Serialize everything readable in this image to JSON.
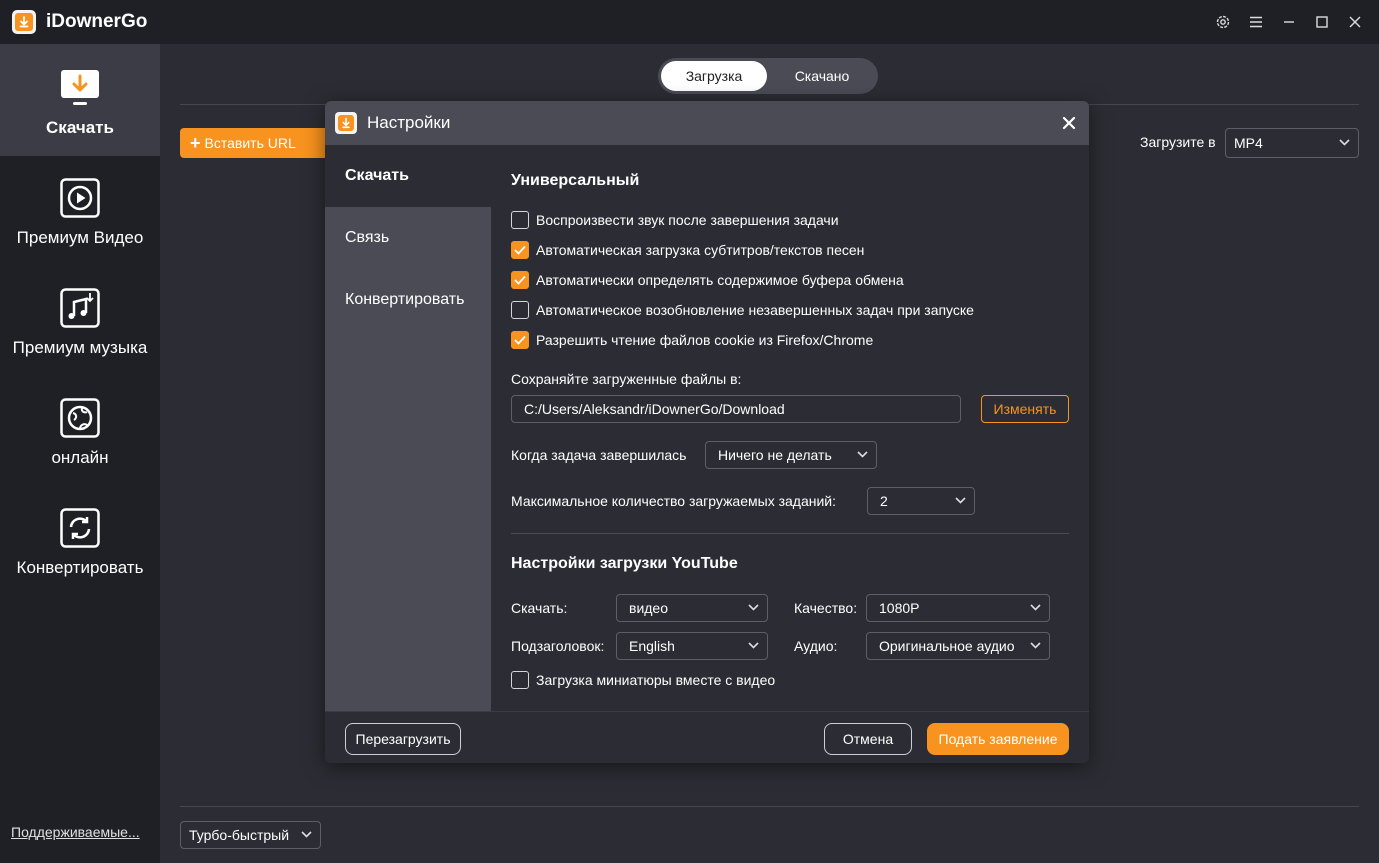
{
  "app": {
    "title": "iDownerGo"
  },
  "sidebar": {
    "items": [
      {
        "label": "Скачать",
        "icon": "download-monitor-icon",
        "active": true
      },
      {
        "label": "Премиум Видео",
        "icon": "play-icon"
      },
      {
        "label": "Премиум музыка",
        "icon": "music-icon"
      },
      {
        "label": "онлайн",
        "icon": "globe-icon"
      },
      {
        "label": "Конвертировать",
        "icon": "convert-icon"
      }
    ],
    "supported_link": "Поддерживаемые..."
  },
  "main": {
    "tabs": [
      {
        "label": "Загрузка",
        "active": true
      },
      {
        "label": "Скачано"
      }
    ],
    "paste_url": "Вставить URL",
    "download_in_label": "Загрузите в",
    "format": "MP4",
    "speed": "Турбо-быстрый"
  },
  "dialog": {
    "title": "Настройки",
    "nav": [
      {
        "label": "Скачать",
        "active": true
      },
      {
        "label": "Связь"
      },
      {
        "label": "Конвертировать"
      }
    ],
    "general": {
      "title": "Универсальный",
      "options": [
        {
          "label": "Воспроизвести звук после завершения задачи",
          "checked": false
        },
        {
          "label": "Автоматическая загрузка субтитров/текстов песен",
          "checked": true
        },
        {
          "label": "Автоматически определять содержимое буфера обмена",
          "checked": true
        },
        {
          "label": "Автоматическое возобновление незавершенных задач при запуске",
          "checked": false
        },
        {
          "label": "Разрешить чтение файлов cookie из Firefox/Chrome",
          "checked": true
        }
      ],
      "save_label": "Сохраняйте загруженные файлы в:",
      "save_path": "C:/Users/Aleksandr/iDownerGo/Download",
      "change_button": "Изменять",
      "on_complete_label": "Когда задача завершилась",
      "on_complete_value": "Ничего не делать",
      "max_tasks_label": "Максимальное количество загружаемых заданий:",
      "max_tasks_value": "2"
    },
    "youtube": {
      "title": "Настройки загрузки YouTube",
      "download_label": "Скачать:",
      "download_value": "видео",
      "quality_label": "Качество:",
      "quality_value": "1080P",
      "subtitle_label": "Подзаголовок:",
      "subtitle_value": "English",
      "audio_label": "Аудио:",
      "audio_value": "Оригинальное аудио",
      "thumbnail_label": "Загрузка миниатюры вместе с видео",
      "thumbnail_checked": false
    },
    "footer": {
      "reset": "Перезагрузить",
      "cancel": "Отмена",
      "submit": "Подать заявление"
    }
  },
  "colors": {
    "accent": "#f7931e",
    "sidebar": "#1f2026",
    "panel": "#4a4b55",
    "bg": "#2c2d34"
  }
}
